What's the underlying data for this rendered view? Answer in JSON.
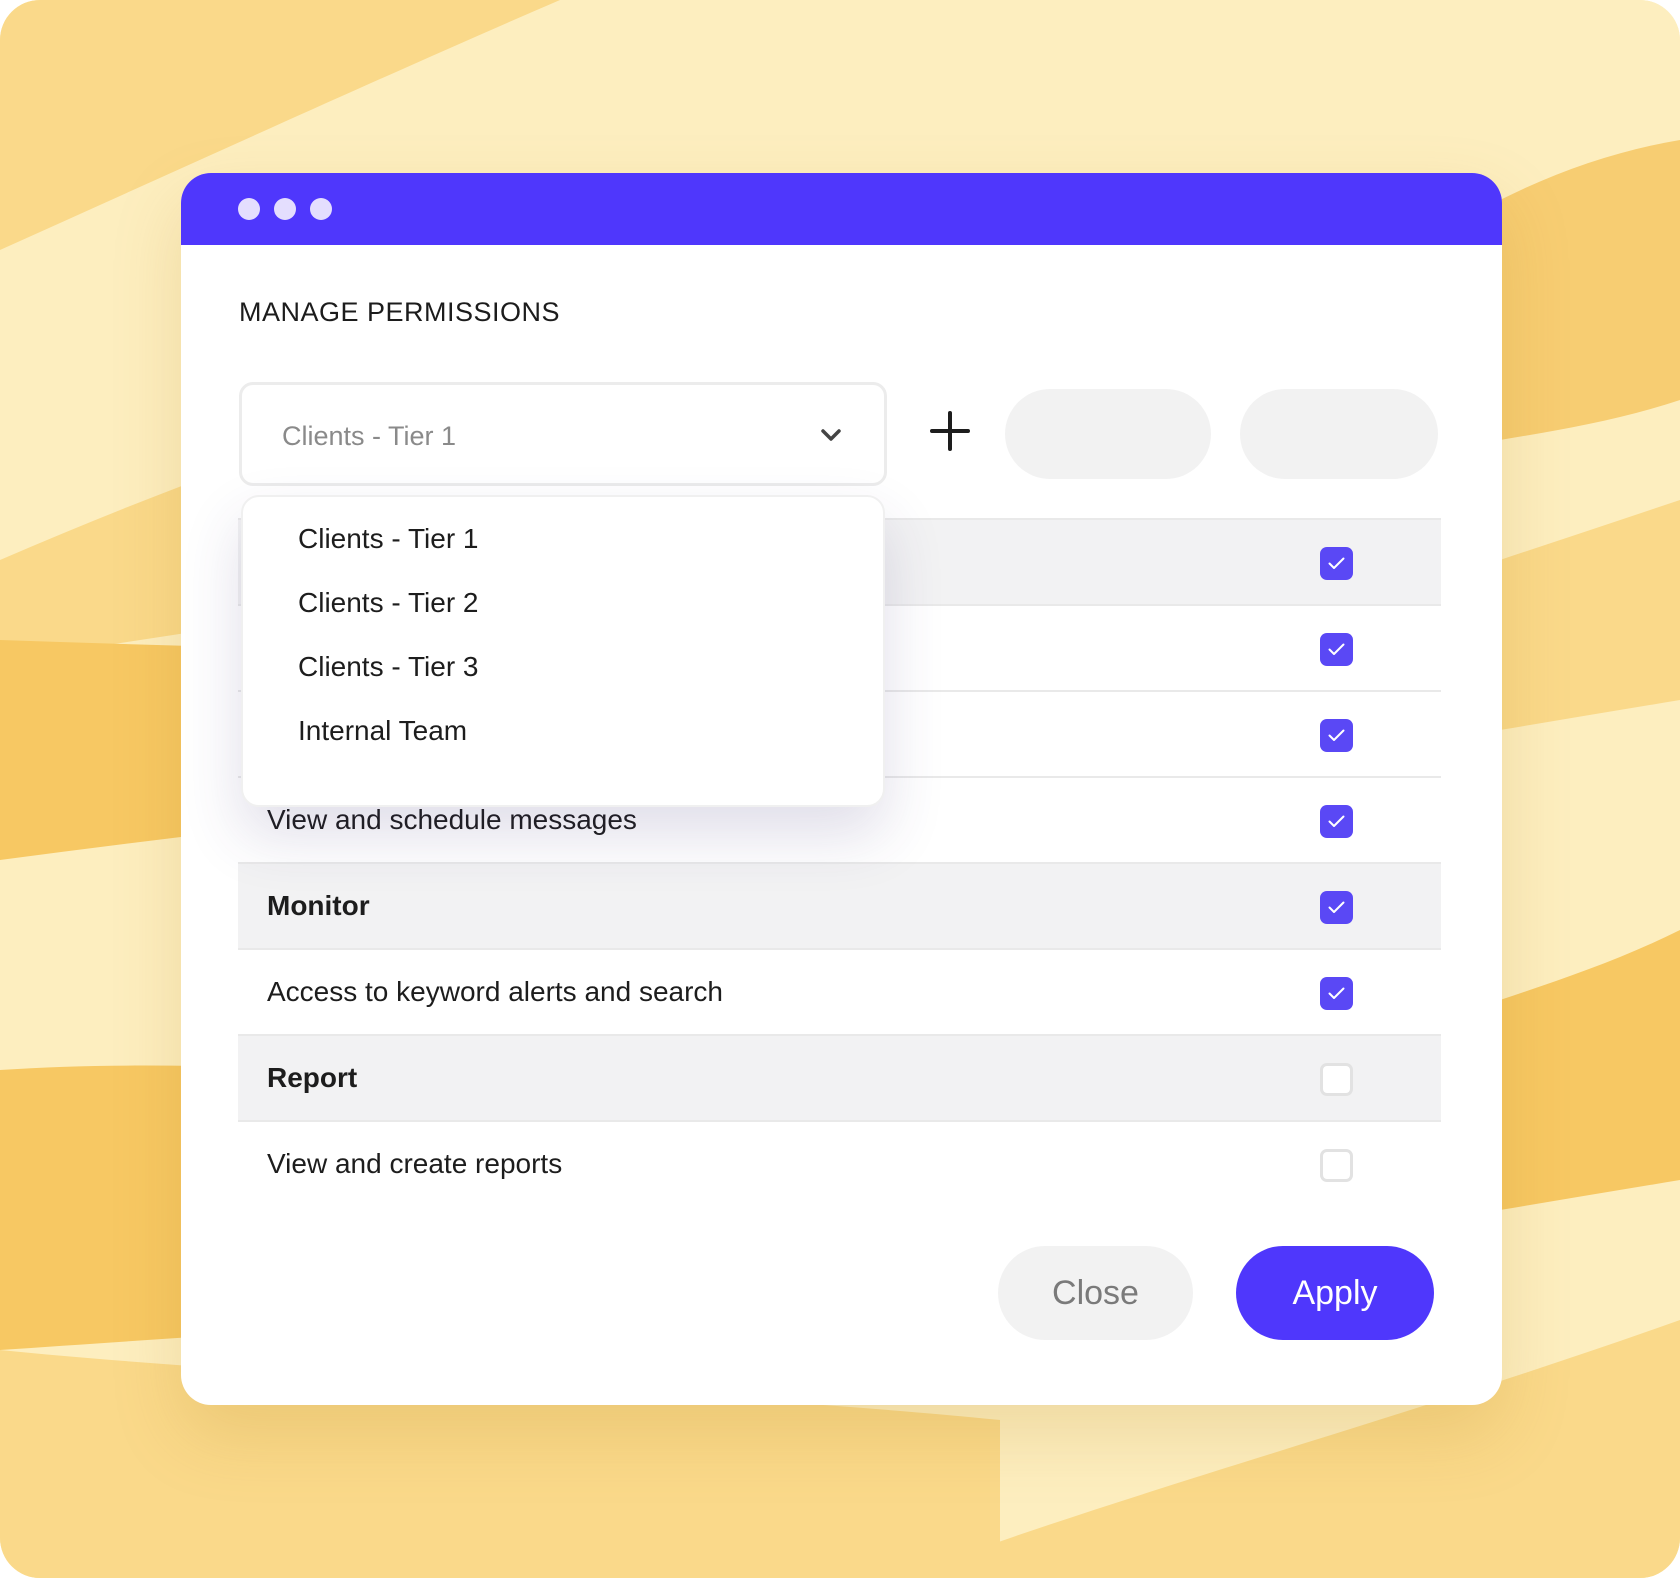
{
  "colors": {
    "accent": "#4f37fc",
    "checkbox_on": "#5a48f5",
    "background": "#fdeebf"
  },
  "window": {
    "title": "MANAGE PERMISSIONS",
    "controls": [
      "dot",
      "dot",
      "dot"
    ]
  },
  "group_select": {
    "value": "Clients - Tier 1",
    "icon": "chevron-down-icon",
    "options": [
      "Clients - Tier 1",
      "Clients - Tier 2",
      "Clients - Tier 3",
      "Internal Team"
    ]
  },
  "add_icon": "plus-icon",
  "permissions": [
    {
      "label": "",
      "section": true,
      "checked": true
    },
    {
      "label": "",
      "section": false,
      "checked": true
    },
    {
      "label": "",
      "section": false,
      "checked": true
    },
    {
      "label": "View and schedule messages",
      "section": false,
      "checked": true
    },
    {
      "label": "Monitor",
      "section": true,
      "checked": true
    },
    {
      "label": "Access to keyword alerts and search",
      "section": false,
      "checked": true
    },
    {
      "label": "Report",
      "section": true,
      "checked": false
    },
    {
      "label": "View and create reports",
      "section": false,
      "checked": false
    }
  ],
  "footer": {
    "close_label": "Close",
    "apply_label": "Apply"
  }
}
